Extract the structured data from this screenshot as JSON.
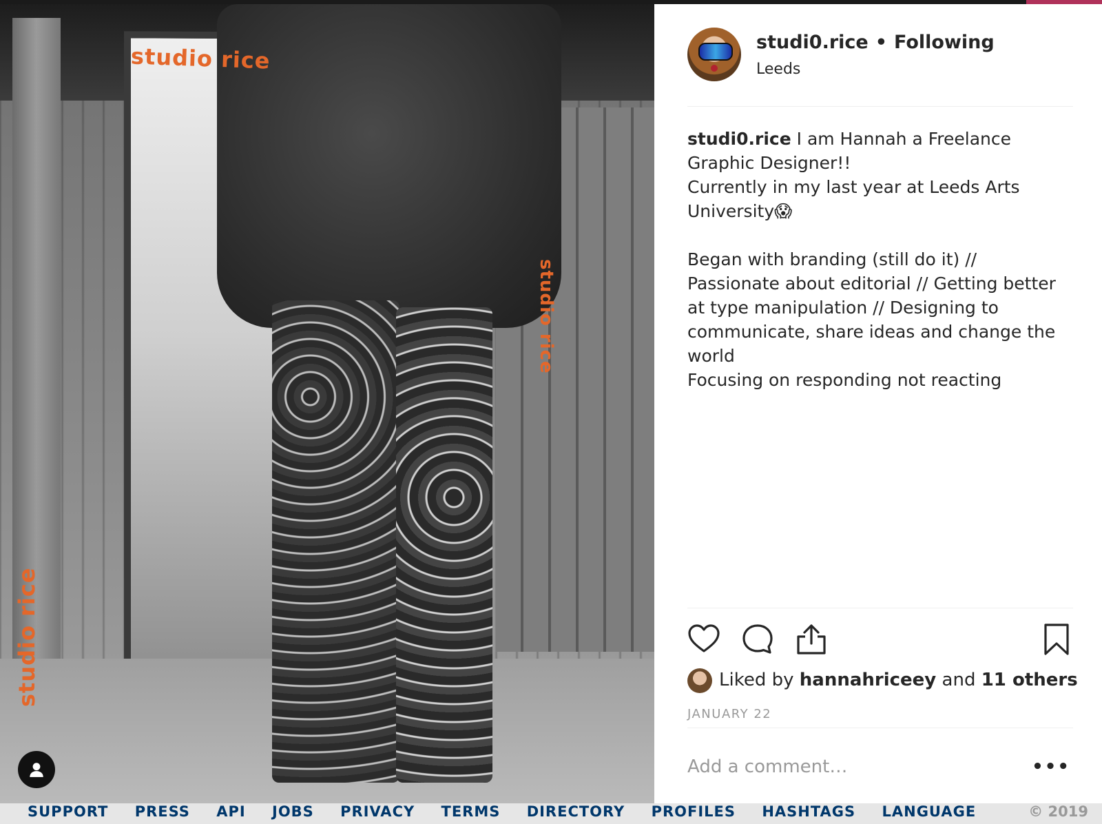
{
  "post": {
    "username": "studi0.rice",
    "separator": "•",
    "follow_status": "Following",
    "location": "Leeds",
    "image_overlay": {
      "brand_top": "studio rice",
      "brand_right": "studio rice",
      "brand_left": "studio rice"
    },
    "caption": {
      "username": "studi0.rice",
      "lines": [
        " I am Hannah a Freelance Graphic Designer!!",
        "Currently in my last year at Leeds Arts University😱",
        "",
        "Began with branding (still do it) // Passionate about editorial // Getting better at type manipulation // Designing to communicate, share ideas and change the world",
        "Focusing on responding not reacting"
      ]
    },
    "likes": {
      "prefix": "Liked by ",
      "user": "hannahriceey",
      "middle": " and ",
      "others": "11 others"
    },
    "date": "JANUARY 22",
    "comment_placeholder": "Add a comment…",
    "more_label": "•••"
  },
  "icons": {
    "like": "heart-icon",
    "comment": "comment-icon",
    "share": "share-icon",
    "save": "bookmark-icon",
    "profile": "user-icon"
  },
  "footer": {
    "links": [
      "SUPPORT",
      "PRESS",
      "API",
      "JOBS",
      "PRIVACY",
      "TERMS",
      "DIRECTORY",
      "PROFILES",
      "HASHTAGS",
      "LANGUAGE"
    ],
    "copyright": "© 2019"
  },
  "colors": {
    "brand_orange": "#e4672a",
    "text_primary": "#262626",
    "text_secondary": "#999999",
    "divider": "#efefef",
    "link_blue": "#00376b"
  }
}
